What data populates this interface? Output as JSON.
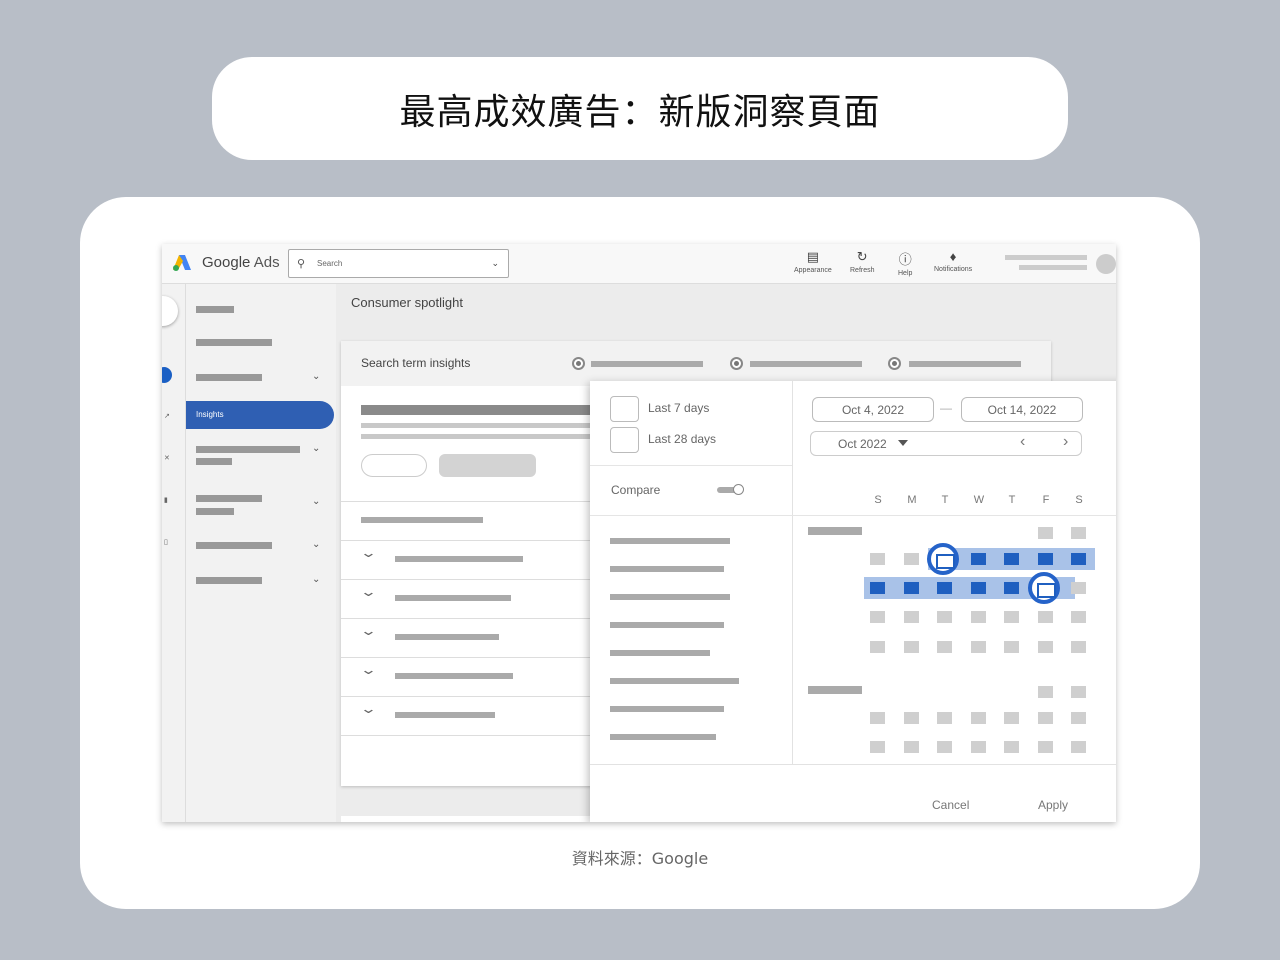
{
  "title": "最高成效廣告：新版洞察頁面",
  "caption": "資料來源：Google",
  "app": {
    "brand_google": "Google",
    "brand_ads": "Ads",
    "search_placeholder": "Search"
  },
  "toolbar": {
    "appearance": "Appearance",
    "refresh": "Refresh",
    "help": "Help",
    "notifications": "Notifications"
  },
  "sidebar": {
    "active_item": "Insights"
  },
  "page": {
    "heading": "Consumer spotlight",
    "panel_title": "Search term insights"
  },
  "date_picker": {
    "options": [
      "Last 7 days",
      "Last 28 days"
    ],
    "compare_label": "Compare",
    "start_date": "Oct 4, 2022",
    "end_date": "Oct 14, 2022",
    "month": "Oct 2022",
    "weekdays": [
      "S",
      "M",
      "T",
      "W",
      "T",
      "F",
      "S"
    ],
    "cancel": "Cancel",
    "apply": "Apply"
  },
  "colors": {
    "accent": "#1f5fc0",
    "range_band": "#a9c2e8",
    "background": "#b8bec7"
  }
}
